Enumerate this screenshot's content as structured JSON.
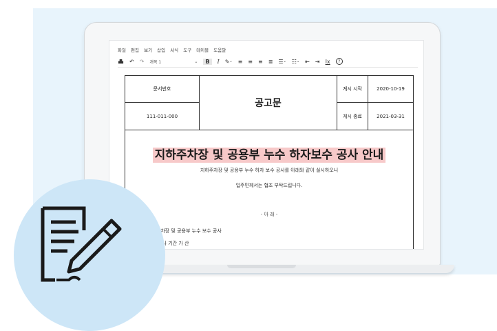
{
  "menu": [
    "파일",
    "편집",
    "보기",
    "삽입",
    "서식",
    "도구",
    "테이블",
    "도움말"
  ],
  "toolbar": {
    "paragraph_style": "개목 1",
    "bold": "B",
    "italic": "I",
    "clear_format": "Ix",
    "help": "?"
  },
  "document": {
    "header": {
      "doc_number_label": "문서번호",
      "doc_number": "111-011-000",
      "center_title": "공고문",
      "start_label": "게시 시작",
      "start_date": "2020-10-19",
      "end_label": "게시 종료",
      "end_date": "2021-03-31"
    },
    "title": "지하주차장 및 공용부 누수 하자보수 공사 안내",
    "body_line1": "지하주차장 및 공용부 누수 하자 보수 공사를 아래와 같이 실시하오니",
    "body_line2": "입주민께서는 협조 부탁드립니다.",
    "separator": "- 아 래 -",
    "item1": "지하주차장 및 공용부 누수 보수 공사",
    "item2": "조기 공사 기간 가 산"
  },
  "colors": {
    "background_panel": "#e8f4fc",
    "circle": "#cde6f7",
    "title_highlight": "#f7c9c9"
  }
}
